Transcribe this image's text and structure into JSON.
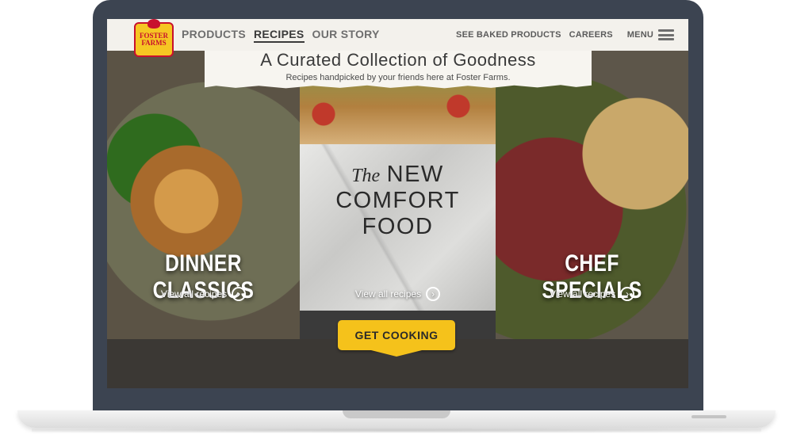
{
  "header": {
    "logo_text": "FOSTER FARMS",
    "nav": [
      "PRODUCTS",
      "RECIPES",
      "OUR STORY"
    ],
    "nav_active": "RECIPES",
    "right_links": [
      "SEE BAKED PRODUCTS",
      "CAREERS"
    ],
    "menu_label": "MENU"
  },
  "banner": {
    "title": "A Curated Collection of Goodness",
    "subtitle": "Recipes handpicked by your friends here at Foster Farms."
  },
  "panels": {
    "left": {
      "title": "DINNER CLASSICS",
      "link": "View all recipes"
    },
    "center": {
      "title_the": "The",
      "title_line1": "NEW",
      "title_line2": "COMFORT",
      "title_line3": "FOOD",
      "link": "View all recipes"
    },
    "right": {
      "title": "CHEF SPECIALS",
      "link": "View all recipes"
    }
  },
  "cta": {
    "label": "GET COOKING"
  },
  "icons": {
    "arrow": "chevron-right-icon",
    "menu": "hamburger-icon",
    "logo": "rooster-logo"
  },
  "colors": {
    "accent": "#f5c21b",
    "brand_red": "#c8102e",
    "frame": "#3c4451"
  }
}
